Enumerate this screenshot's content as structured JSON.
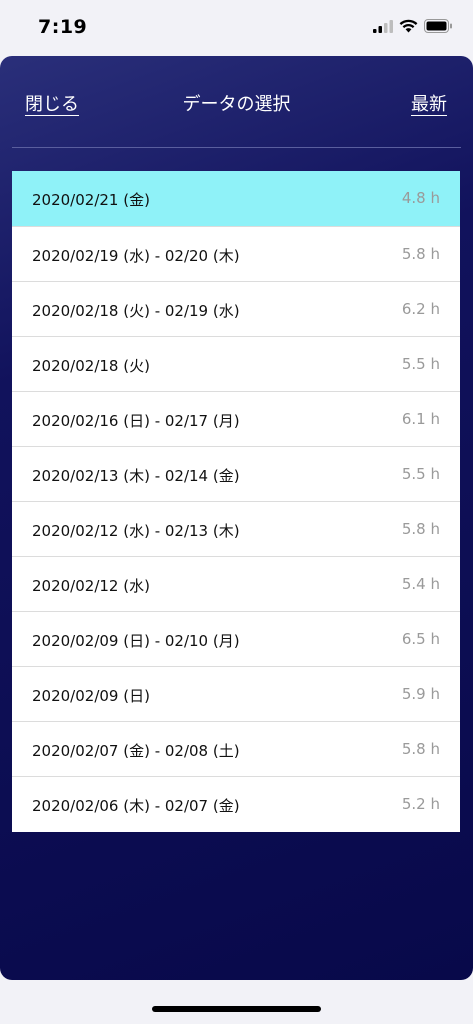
{
  "status_bar": {
    "time": "7:19",
    "icons": [
      "cellular-signal-icon",
      "wifi-icon",
      "battery-icon"
    ]
  },
  "header": {
    "close_label": "閉じる",
    "title": "データの選択",
    "latest_label": "最新"
  },
  "colors": {
    "background_gradient": [
      "#2a2f7a",
      "#08094a"
    ],
    "selected_row": "#8ff2f8",
    "hours_text": "#9a9a9a"
  },
  "records": [
    {
      "date": "2020/02/21 (金)",
      "hours": "4.8 h",
      "selected": true
    },
    {
      "date": "2020/02/19 (水) - 02/20 (木)",
      "hours": "5.8 h"
    },
    {
      "date": "2020/02/18 (火) - 02/19 (水)",
      "hours": "6.2 h"
    },
    {
      "date": "2020/02/18 (火)",
      "hours": "5.5 h"
    },
    {
      "date": "2020/02/16 (日) - 02/17 (月)",
      "hours": "6.1 h"
    },
    {
      "date": "2020/02/13 (木) - 02/14 (金)",
      "hours": "5.5 h"
    },
    {
      "date": "2020/02/12 (水) - 02/13 (木)",
      "hours": "5.8 h"
    },
    {
      "date": "2020/02/12 (水)",
      "hours": "5.4 h"
    },
    {
      "date": "2020/02/09 (日) - 02/10 (月)",
      "hours": "6.5 h"
    },
    {
      "date": "2020/02/09 (日)",
      "hours": "5.9 h"
    },
    {
      "date": "2020/02/07 (金) - 02/08 (土)",
      "hours": "5.8 h"
    },
    {
      "date": "2020/02/06 (木) - 02/07 (金)",
      "hours": "5.2 h"
    }
  ]
}
